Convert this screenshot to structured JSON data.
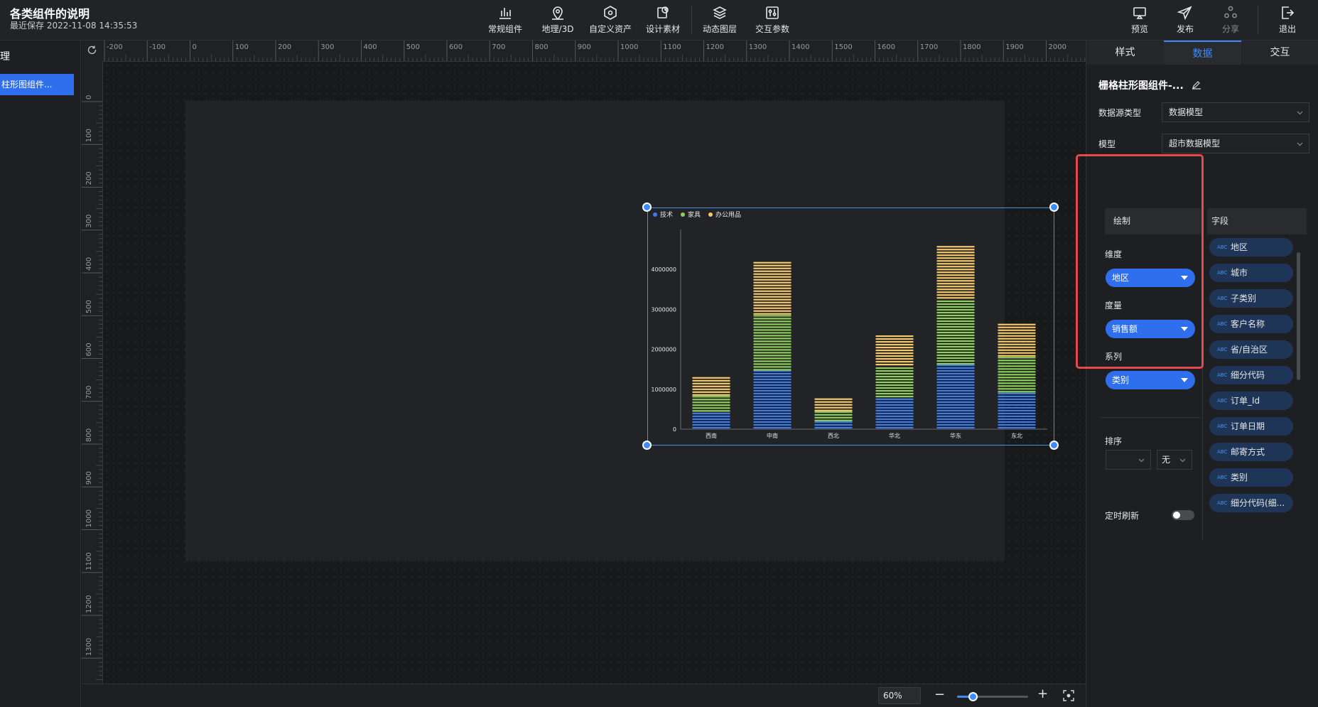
{
  "app": {
    "title": "各类组件的说明",
    "save_status": "最近保存 2022-11-08 14:35:53"
  },
  "toolbar": {
    "tools": [
      {
        "label": "常规组件",
        "icon": "bar-chart-icon"
      },
      {
        "label": "地理/3D",
        "icon": "map-pin-icon"
      },
      {
        "label": "自定义资产",
        "icon": "hexagon-icon"
      },
      {
        "label": "设计素材",
        "icon": "material-icon"
      },
      {
        "label": "动态图层",
        "icon": "layers-icon"
      },
      {
        "label": "交互参数",
        "icon": "sliders-icon"
      }
    ],
    "actions": [
      {
        "label": "预览",
        "icon": "monitor-icon"
      },
      {
        "label": "发布",
        "icon": "send-icon"
      },
      {
        "label": "分享",
        "icon": "share-icon"
      },
      {
        "label": "退出",
        "icon": "exit-icon"
      }
    ]
  },
  "left_panel": {
    "heading": "理",
    "selected_item": "柱形图组件..."
  },
  "ruler": {
    "top_labels": [
      "-200",
      "-100",
      "0",
      "100",
      "200",
      "300",
      "400",
      "500",
      "600",
      "700",
      "800",
      "900",
      "1000",
      "1100",
      "1200",
      "1300",
      "1400",
      "1500",
      "1600",
      "1700",
      "1800",
      "1900",
      "2000"
    ],
    "left_labels": [
      "0",
      "100",
      "200",
      "300",
      "400",
      "500",
      "600",
      "700",
      "800",
      "900",
      "1000",
      "1100",
      "1200",
      "1300"
    ]
  },
  "chart_data": {
    "type": "bar",
    "stacked": true,
    "style": "grid-striped",
    "categories": [
      "西南",
      "中南",
      "西北",
      "华北",
      "华东",
      "东北"
    ],
    "series": [
      {
        "name": "技术",
        "color": "#3a7bef",
        "values": [
          420000,
          1450000,
          180000,
          780000,
          1600000,
          900000
        ]
      },
      {
        "name": "家具",
        "color": "#8fd05b",
        "values": [
          400000,
          1400000,
          250000,
          800000,
          1650000,
          900000
        ]
      },
      {
        "name": "办公用品",
        "color": "#f5c96b",
        "values": [
          480000,
          1340000,
          370000,
          770000,
          1370000,
          810000
        ]
      }
    ],
    "y_ticks": [
      "0",
      "1000000",
      "2000000",
      "3000000",
      "4000000"
    ],
    "ylim": [
      0,
      5000000
    ],
    "legend": "top-left"
  },
  "zoom": {
    "value": "60%",
    "minus": "−",
    "plus": "+",
    "level": 0.22
  },
  "right_panel": {
    "tabs": [
      "样式",
      "数据",
      "交互"
    ],
    "active_tab": 1,
    "component_name": "栅格柱形图组件-...",
    "datasource_type_label": "数据源类型",
    "datasource_type_value": "数据模型",
    "model_label": "模型",
    "model_value": "超市数据模型",
    "draw_header": "绘制",
    "fields_header": "字段",
    "dimension_label": "维度",
    "dimension_value": "地区",
    "measure_label": "度量",
    "measure_value": "销售额",
    "series_label": "系列",
    "series_value": "类别",
    "sort_label": "排序",
    "sort_order": "无",
    "refresh_label": "定时刷新",
    "field_type_label": "ABC",
    "fields": [
      "地区",
      "城市",
      "子类别",
      "客户名称",
      "省/自治区",
      "细分代码",
      "订单_Id",
      "订单日期",
      "邮寄方式",
      "类别",
      "细分代码(细..."
    ]
  }
}
